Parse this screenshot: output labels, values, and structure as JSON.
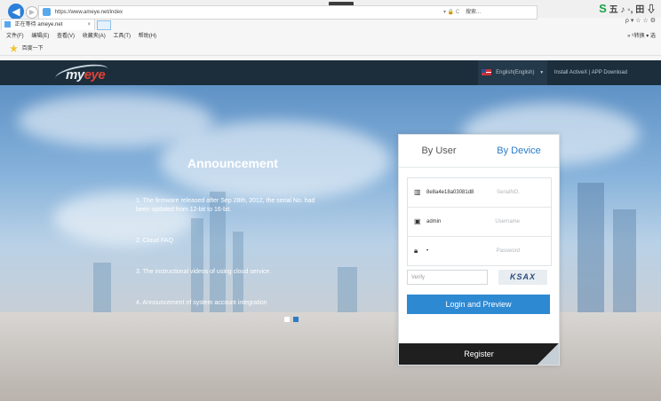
{
  "browser": {
    "back_icon": "back-arrow-icon",
    "forward_icon": "forward-arrow-icon",
    "url": "https://www.ameye.net/index",
    "address_separator": "▾ 🔒 C",
    "search_placeholder": "搜索...",
    "tab_title": "正在等待 ameye.net",
    "tab_close": "×",
    "menu": [
      "文件(F)",
      "编辑(E)",
      "查看(V)",
      "收藏夹(A)",
      "工具(T)",
      "帮助(H)"
    ],
    "menu_right": "» ⁸转换 ▾ 选",
    "favorites": "百度一下",
    "tray": "五 ♪ ◦, 田 ⇩",
    "tray2": "ρ ▾ ☆ ☆ ⚙"
  },
  "header": {
    "logo_main": "my",
    "logo_accent": "eye",
    "language": "English(English)",
    "install": "Install ActiveX",
    "divider": "|",
    "app_download": "APP Download"
  },
  "announcement": {
    "title": "Announcement",
    "items": [
      "1. The firmware released after Sep 28th, 2012, the serial No. had been updated from 12-bit to 16-bit.",
      "2. Cloud FAQ",
      "3. The instructional videos of using cloud service.",
      "4. Announcement of system account integration"
    ]
  },
  "login": {
    "tab_user": "By User",
    "tab_device": "By Device",
    "serial_value": "8e8a4e18a03081d8",
    "serial_placeholder": "SerialNO.",
    "username_value": "admin",
    "username_placeholder": "Username",
    "password_value": "•",
    "password_placeholder": "Password",
    "verify_placeholder": "Verify",
    "captcha": "KSAX",
    "login_button": "Login and Preview",
    "register_button": "Register"
  }
}
